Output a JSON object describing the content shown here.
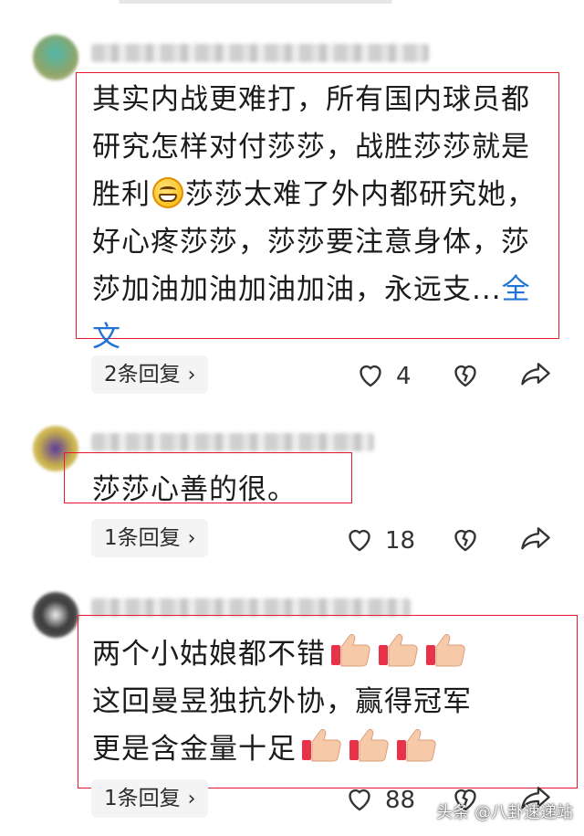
{
  "comments": [
    {
      "text": "其实内战更难打，所有国内球员都研究怎样对付莎莎，战胜莎莎就是胜利",
      "text_after_emoji": "莎莎太难了外内都研究她，好心疼莎莎，莎莎要注意身体，莎莎加油加油加油加油，永远支...",
      "more_label": "全文",
      "emoji": "grinning-face-icon",
      "reply_label": "2条回复",
      "like_count": "4"
    },
    {
      "text": "莎莎心善的很。",
      "reply_label": "1条回复",
      "like_count": "18"
    },
    {
      "line1": "两个小姑娘都不错",
      "line2": "这回曼昱独抗外协，赢得冠军",
      "line3": "更是含金量十足",
      "emoji": "thumbs-up-icon",
      "reply_label": "1条回复",
      "like_count": "88"
    }
  ],
  "icons": {
    "like": "heart-outline-icon",
    "dislike": "broken-heart-icon",
    "share": "share-arrow-icon",
    "chevron": "chevron-right-icon"
  },
  "watermark": "头条 @八卦速递站",
  "colors": {
    "annotation_box": "#e8192c",
    "link": "#1f74d6",
    "pill_bg": "#f4f4f4"
  }
}
